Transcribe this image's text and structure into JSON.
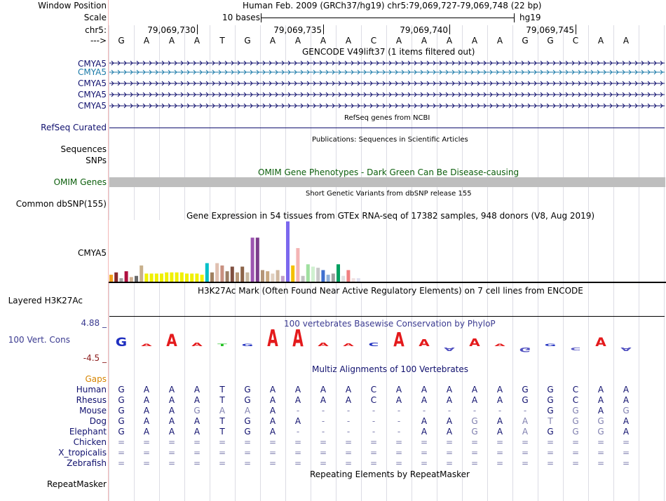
{
  "header": {
    "window_position_label": "Window Position",
    "window_position_text": "Human Feb. 2009 (GRCh37/hg19)   chr5:79,069,727-79,069,748 (22 bp)",
    "scale_label": "Scale",
    "scale_text": "10 bases",
    "scale_assembly": "hg19",
    "chr_label": "chr5:",
    "strand_label": "--->",
    "ticks": [
      "79,069,730",
      "79,069,735",
      "79,069,740",
      "79,069,745"
    ]
  },
  "sequence": [
    "G",
    "A",
    "A",
    "A",
    "T",
    "G",
    "A",
    "A",
    "A",
    "A",
    "C",
    "A",
    "A",
    "A",
    "A",
    "A",
    "G",
    "G",
    "C",
    "A",
    "A"
  ],
  "gencode": {
    "title": "GENCODE V49lift37 (1 items filtered out)",
    "labels": [
      "CMYA5",
      "CMYA5",
      "CMYA5",
      "CMYA5",
      "CMYA5"
    ],
    "highlight_color": "#1a7aa8",
    "main_color": "#10106e"
  },
  "refseq": {
    "title": "RefSeq genes from NCBI",
    "label": "RefSeq Curated"
  },
  "publications": {
    "title": "Publications: Sequences in Scientific Articles",
    "labels": [
      "Sequences",
      "SNPs"
    ]
  },
  "omim": {
    "title": "OMIM Gene Phenotypes - Dark Green Can Be Disease-causing",
    "label": "OMIM Genes"
  },
  "dbsnp": {
    "title": "Short Genetic Variants from dbSNP release 155",
    "label": "Common dbSNP(155)"
  },
  "gtex": {
    "title": "Gene Expression in 54 tissues from GTEx RNA-seq of 17382 samples, 948 donors (V8, Aug 2019)",
    "label": "CMYA5",
    "bars": [
      {
        "v": 12,
        "c": "#f4a11d"
      },
      {
        "v": 16,
        "c": "#8b2a2a"
      },
      {
        "v": 6,
        "c": "#a0a0a0"
      },
      {
        "v": 18,
        "c": "#b01040"
      },
      {
        "v": 8,
        "c": "#d0b090"
      },
      {
        "v": 10,
        "c": "#6a6a6a"
      },
      {
        "v": 28,
        "c": "#c8b08c"
      },
      {
        "v": 14,
        "c": "#f0f000"
      },
      {
        "v": 14,
        "c": "#f0f000"
      },
      {
        "v": 14,
        "c": "#f0f000"
      },
      {
        "v": 14,
        "c": "#f0f000"
      },
      {
        "v": 16,
        "c": "#f0f000"
      },
      {
        "v": 16,
        "c": "#f0f000"
      },
      {
        "v": 16,
        "c": "#f0f000"
      },
      {
        "v": 16,
        "c": "#f0f000"
      },
      {
        "v": 14,
        "c": "#f0f000"
      },
      {
        "v": 14,
        "c": "#f0f000"
      },
      {
        "v": 14,
        "c": "#f0f000"
      },
      {
        "v": 12,
        "c": "#f0f000"
      },
      {
        "v": 32,
        "c": "#00c0c8"
      },
      {
        "v": 16,
        "c": "#a08060"
      },
      {
        "v": 32,
        "c": "#e0c0b0"
      },
      {
        "v": 28,
        "c": "#c89080"
      },
      {
        "v": 18,
        "c": "#9c7e64"
      },
      {
        "v": 26,
        "c": "#805040"
      },
      {
        "v": 16,
        "c": "#b89878"
      },
      {
        "v": 26,
        "c": "#8c6448"
      },
      {
        "v": 16,
        "c": "#c8b8a0"
      },
      {
        "v": 76,
        "c": "#9c54b0"
      },
      {
        "v": 76,
        "c": "#7c3c8c"
      },
      {
        "v": 20,
        "c": "#b49678"
      },
      {
        "v": 18,
        "c": "#c8a880"
      },
      {
        "v": 14,
        "c": "#e0d0c0"
      },
      {
        "v": 20,
        "c": "#d0b8a0"
      },
      {
        "v": 10,
        "c": "#c0a0c8"
      },
      {
        "v": 104,
        "c": "#7b68ee"
      },
      {
        "v": 28,
        "c": "#f4c000"
      },
      {
        "v": 58,
        "c": "#f4b4b4"
      },
      {
        "v": 10,
        "c": "#c0c0c0"
      },
      {
        "v": 30,
        "c": "#a0e0a0"
      },
      {
        "v": 26,
        "c": "#d0f0d0"
      },
      {
        "v": 24,
        "c": "#c8c8c8"
      },
      {
        "v": 20,
        "c": "#4070d0"
      },
      {
        "v": 12,
        "c": "#90b0d8"
      },
      {
        "v": 14,
        "c": "#a0a0a0"
      },
      {
        "v": 30,
        "c": "#00a060"
      },
      {
        "v": 10,
        "c": "#e0e0e0"
      },
      {
        "v": 20,
        "c": "#f08080"
      },
      {
        "v": 6,
        "c": "#f0e0e0"
      },
      {
        "v": 6,
        "c": "#e0e0f0"
      }
    ]
  },
  "h3k27ac": {
    "title": "H3K27Ac Mark (Often Found Near Active Regulatory Elements) on 7 cell lines from ENCODE",
    "label": "Layered H3K27Ac"
  },
  "phylop": {
    "title": "100 vertebrates Basewise Conservation by PhyloP",
    "label": "100 Vert. Cons",
    "ymax": "4.88 _",
    "ymin": "-4.5 _",
    "scores": [
      1.0,
      0,
      1.4,
      0.4,
      0.2,
      0.1,
      1.9,
      2.1,
      0.4,
      0.3,
      0.4,
      1.6,
      0.8,
      -0.4,
      0.9,
      0,
      -0.5,
      0,
      -0.3,
      1.0,
      -0.4
    ]
  },
  "multiz": {
    "title": "Multiz Alignments of 100 Vertebrates",
    "gaps_label": "Gaps",
    "species": [
      {
        "name": "Human",
        "seq": "GAAATGAAAACAAAAAGGCAA"
      },
      {
        "name": "Rhesus",
        "seq": "GAAATGAAAACAAAAAGGCAA"
      },
      {
        "name": "Mouse",
        "seq": "GAAGAAA----------GGAG"
      },
      {
        "name": "Dog",
        "seq": "GAAATGAA----AAGAATGGAG"
      },
      {
        "name": "Elephant",
        "seq": "GAAATGA-----AAGAAGGGAG"
      },
      {
        "name": "Chicken",
        "seq": "====================="
      },
      {
        "name": "X_tropicalis",
        "seq": "====================="
      },
      {
        "name": "Zebrafish",
        "seq": "====================="
      }
    ]
  },
  "repeatmasker": {
    "title": "Repeating Elements by RepeatMasker",
    "label": "RepeatMasker"
  }
}
